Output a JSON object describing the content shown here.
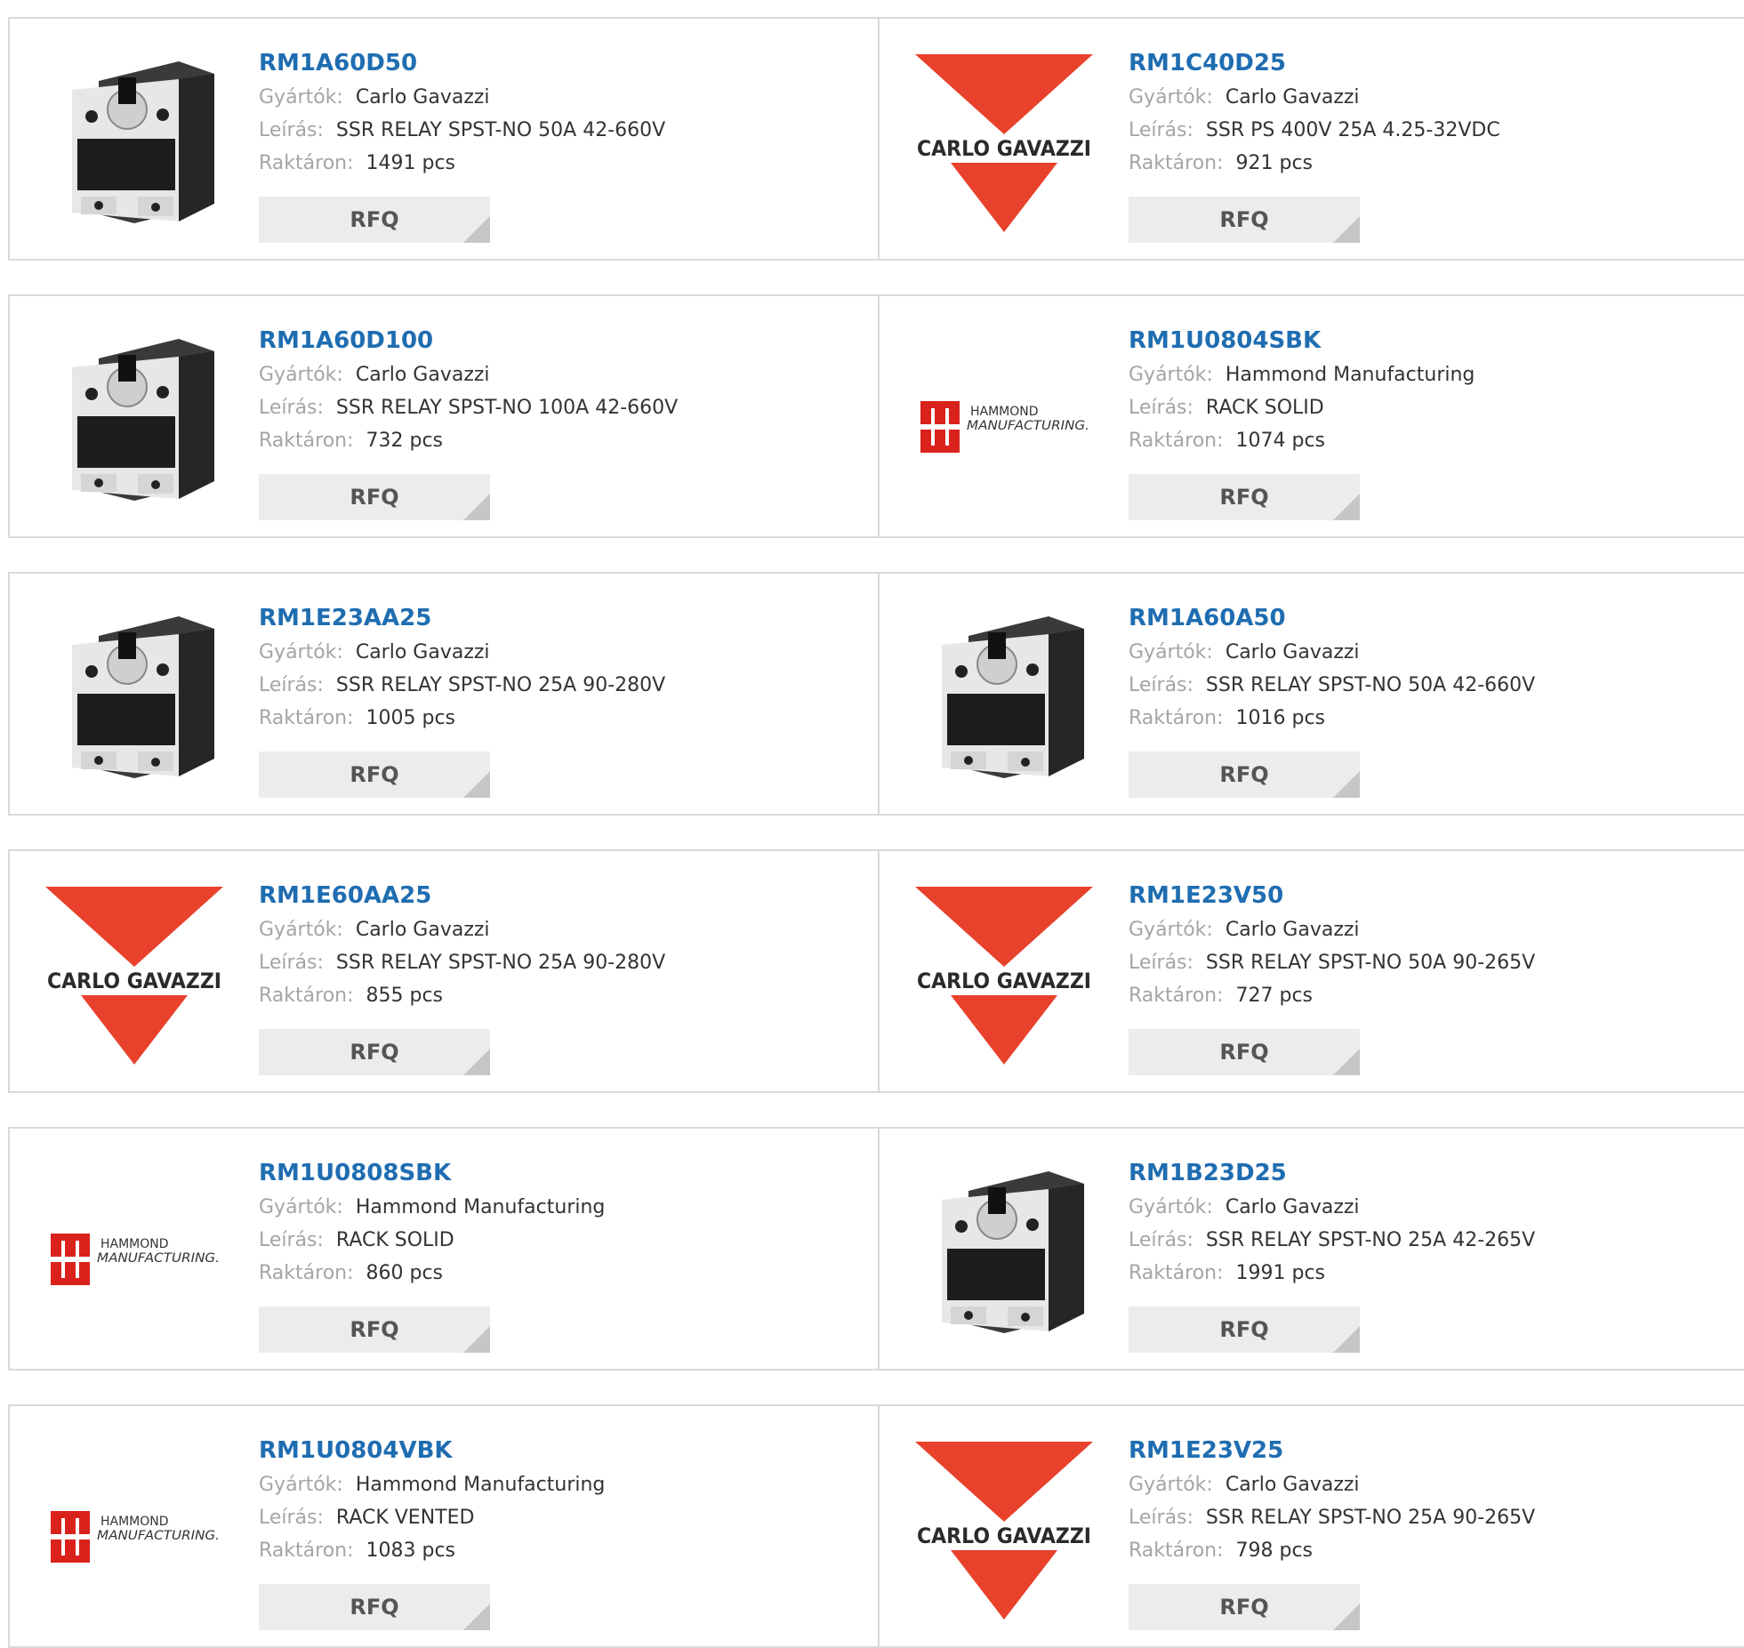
{
  "labels": {
    "manufacturer": "Gyártók:",
    "description": "Leírás:",
    "stock": "Raktáron:",
    "rfq": "RFQ"
  },
  "logos": {
    "carlo_gavazzi": "CARLO GAVAZZI",
    "hammond_line1": "HAMMOND",
    "hammond_line2": "MANUFACTURING."
  },
  "colors": {
    "link": "#1f6db1",
    "carlo_red": "#e8412c",
    "hammond_red": "#d9221c"
  },
  "products": [
    {
      "part": "RM1A60D50",
      "manufacturer": "Carlo Gavazzi",
      "description": "SSR RELAY SPST-NO 50A 42-660V",
      "stock": "1491 pcs",
      "image": "relay"
    },
    {
      "part": "RM1C40D25",
      "manufacturer": "Carlo Gavazzi",
      "description": "SSR PS 400V 25A 4.25-32VDC",
      "stock": "921 pcs",
      "image": "carlo-logo"
    },
    {
      "part": "RM1A60D100",
      "manufacturer": "Carlo Gavazzi",
      "description": "SSR RELAY SPST-NO 100A 42-660V",
      "stock": "732 pcs",
      "image": "relay"
    },
    {
      "part": "RM1U0804SBK",
      "manufacturer": "Hammond Manufacturing",
      "description": "RACK SOLID",
      "stock": "1074 pcs",
      "image": "hammond-logo"
    },
    {
      "part": "RM1E23AA25",
      "manufacturer": "Carlo Gavazzi",
      "description": "SSR RELAY SPST-NO 25A 90-280V",
      "stock": "1005 pcs",
      "image": "relay"
    },
    {
      "part": "RM1A60A50",
      "manufacturer": "Carlo Gavazzi",
      "description": "SSR RELAY SPST-NO 50A 42-660V",
      "stock": "1016 pcs",
      "image": "relay"
    },
    {
      "part": "RM1E60AA25",
      "manufacturer": "Carlo Gavazzi",
      "description": "SSR RELAY SPST-NO 25A 90-280V",
      "stock": "855 pcs",
      "image": "carlo-logo"
    },
    {
      "part": "RM1E23V50",
      "manufacturer": "Carlo Gavazzi",
      "description": "SSR RELAY SPST-NO 50A 90-265V",
      "stock": "727 pcs",
      "image": "carlo-logo"
    },
    {
      "part": "RM1U0808SBK",
      "manufacturer": "Hammond Manufacturing",
      "description": "RACK SOLID",
      "stock": "860 pcs",
      "image": "hammond-logo"
    },
    {
      "part": "RM1B23D25",
      "manufacturer": "Carlo Gavazzi",
      "description": "SSR RELAY SPST-NO 25A 42-265V",
      "stock": "1991 pcs",
      "image": "relay"
    },
    {
      "part": "RM1U0804VBK",
      "manufacturer": "Hammond Manufacturing",
      "description": "RACK VENTED",
      "stock": "1083 pcs",
      "image": "hammond-logo"
    },
    {
      "part": "RM1E23V25",
      "manufacturer": "Carlo Gavazzi",
      "description": "SSR RELAY SPST-NO 25A 90-265V",
      "stock": "798 pcs",
      "image": "carlo-logo"
    }
  ]
}
